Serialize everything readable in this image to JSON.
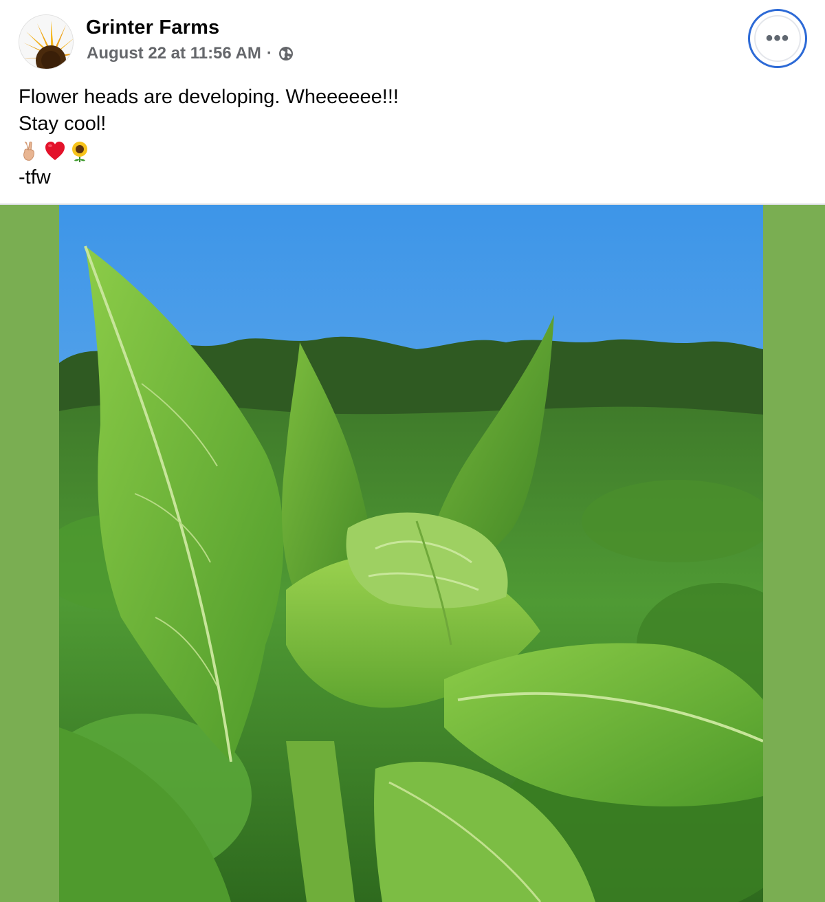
{
  "post": {
    "author": "Grinter Farms",
    "timestamp": "August 22 at 11:56 AM",
    "separator": "·",
    "privacy_icon": "globe-icon",
    "more_icon": "more-options-icon",
    "more_label": "•••",
    "text_lines": [
      "Flower heads are developing. Wheeeeee!!!",
      "Stay cool!"
    ],
    "emojis": [
      "victory-hand",
      "red-heart",
      "sunflower"
    ],
    "signature": "-tfw"
  },
  "colors": {
    "frame_green": "#7aae52",
    "accent_blue": "#2d6ad6",
    "meta_gray": "#65676b",
    "sky_blue": "#4da2ea"
  }
}
